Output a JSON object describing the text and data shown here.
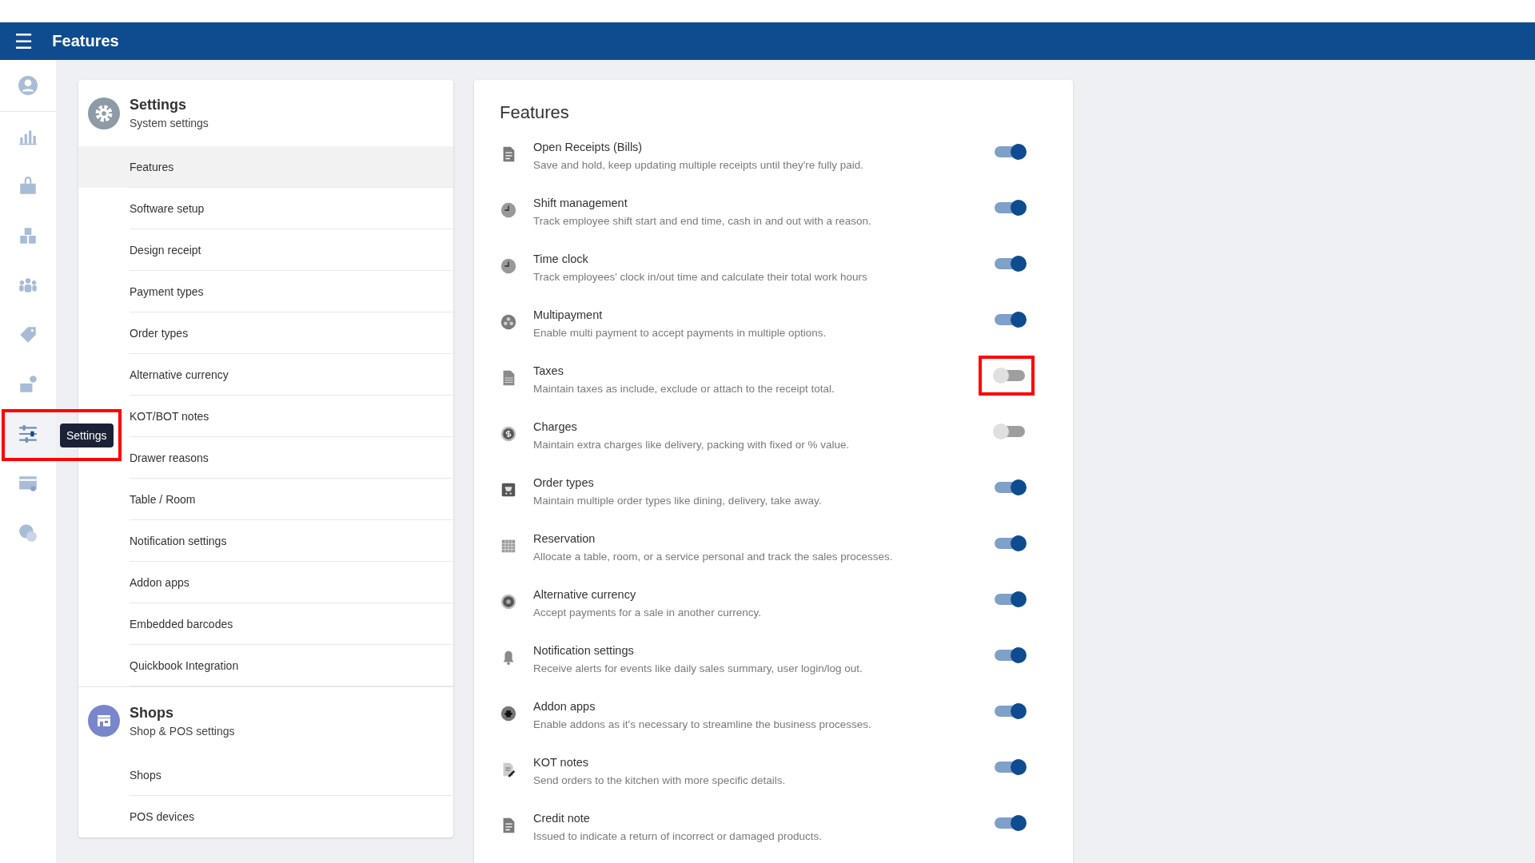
{
  "header": {
    "menu_icon": "☰",
    "title": "Features"
  },
  "rail": [
    {
      "kind": "account",
      "selected": false,
      "highlighted": false
    },
    {
      "kind": "chart",
      "selected": false,
      "highlighted": false
    },
    {
      "kind": "bag",
      "selected": false,
      "highlighted": false
    },
    {
      "kind": "boxes",
      "selected": false,
      "highlighted": false
    },
    {
      "kind": "people",
      "selected": false,
      "highlighted": false
    },
    {
      "kind": "tag",
      "selected": false,
      "highlighted": false
    },
    {
      "kind": "register",
      "selected": false,
      "highlighted": false
    },
    {
      "kind": "sliders",
      "selected": true,
      "highlighted": true,
      "tooltip": "Settings"
    },
    {
      "kind": "card",
      "selected": false,
      "highlighted": false
    },
    {
      "kind": "help",
      "selected": false,
      "highlighted": false
    }
  ],
  "settings_menu": [
    {
      "kind": "gear",
      "title": "Settings",
      "subtitle": "System settings",
      "items": [
        {
          "label": "Features",
          "selected": true
        },
        {
          "label": "Software setup",
          "selected": false
        },
        {
          "label": "Design receipt",
          "selected": false
        },
        {
          "label": "Payment types",
          "selected": false
        },
        {
          "label": "Order types",
          "selected": false
        },
        {
          "label": "Alternative currency",
          "selected": false
        },
        {
          "label": "KOT/BOT notes",
          "selected": false
        },
        {
          "label": "Drawer reasons",
          "selected": false
        },
        {
          "label": "Table / Room",
          "selected": false
        },
        {
          "label": "Notification settings",
          "selected": false
        },
        {
          "label": "Addon apps",
          "selected": false
        },
        {
          "label": "Embedded barcodes",
          "selected": false
        },
        {
          "label": "Quickbook Integration",
          "selected": false
        }
      ]
    },
    {
      "kind": "shop",
      "title": "Shops",
      "subtitle": "Shop & POS settings",
      "items": [
        {
          "label": "Shops",
          "selected": false
        },
        {
          "label": "POS devices",
          "selected": false
        }
      ]
    }
  ],
  "features": {
    "title": "Features",
    "items": [
      {
        "kind": "document",
        "title": "Open Receipts (Bills)",
        "description": "Save and hold, keep updating multiple receipts until they're fully paid.",
        "on": true,
        "highlighted": false
      },
      {
        "kind": "clock",
        "title": "Shift management",
        "description": "Track employee shift start and end time, cash in and out with a reason.",
        "on": true,
        "highlighted": false
      },
      {
        "kind": "clock",
        "title": "Time clock",
        "description": "Track employees' clock in/out time and calculate their total work hours",
        "on": true,
        "highlighted": false
      },
      {
        "kind": "coins",
        "title": "Multipayment",
        "description": "Enable multi payment to accept payments in multiple options.",
        "on": true,
        "highlighted": false
      },
      {
        "kind": "receipt",
        "title": "Taxes",
        "description": "Maintain taxes as include, exclude or attach to the receipt total.",
        "on": false,
        "highlighted": true
      },
      {
        "kind": "dollar",
        "title": "Charges",
        "description": "Maintain extra charges like delivery, packing with fixed or % value.",
        "on": false,
        "highlighted": false
      },
      {
        "kind": "cart",
        "title": "Order types",
        "description": "Maintain multiple order types like dining, delivery, take away.",
        "on": true,
        "highlighted": false
      },
      {
        "kind": "calendar",
        "title": "Reservation",
        "description": "Allocate a table, room, or a service personal and track the sales processes.",
        "on": true,
        "highlighted": false
      },
      {
        "kind": "currency",
        "title": "Alternative currency",
        "description": "Accept payments for a sale in another currency.",
        "on": true,
        "highlighted": false
      },
      {
        "kind": "bell",
        "title": "Notification settings",
        "description": "Receive alerts for events like daily sales summary, user login/log out.",
        "on": true,
        "highlighted": false
      },
      {
        "kind": "puzzle",
        "title": "Addon apps",
        "description": "Enable addons as it's necessary to streamline the business processes.",
        "on": true,
        "highlighted": false
      },
      {
        "kind": "note",
        "title": "KOT notes",
        "description": "Send orders to the kitchen with more specific details.",
        "on": true,
        "highlighted": false
      },
      {
        "kind": "document",
        "title": "Credit note",
        "description": "Issued to indicate a return of incorrect or damaged products.",
        "on": true,
        "highlighted": false
      }
    ]
  }
}
